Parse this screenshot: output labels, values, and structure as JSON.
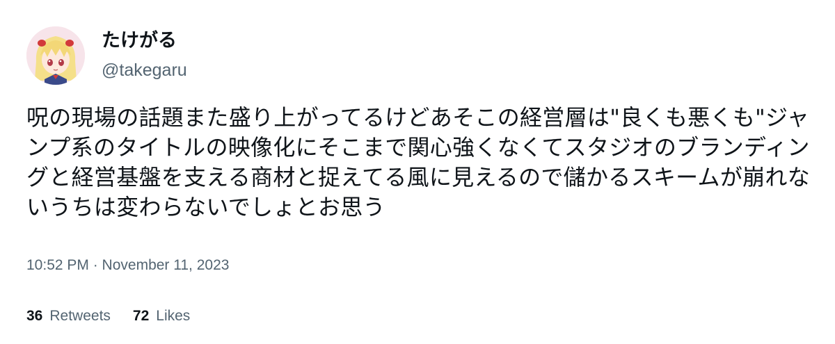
{
  "author": {
    "display_name": "たけがる",
    "handle": "@takegaru"
  },
  "tweet": {
    "text": "呪の現場の話題また盛り上がってるけどあそこの経営層は\"良くも悪くも\"ジャンプ系のタイトルの映像化にそこまで関心強くなくてスタジオのブランディングと経営基盤を支える商材と捉えてる風に見えるので儲かるスキームが崩れないうちは変わらないでしょとお思う",
    "timestamp": "10:52 PM · November 11, 2023"
  },
  "stats": {
    "retweets_count": "36",
    "retweets_label": "Retweets",
    "likes_count": "72",
    "likes_label": "Likes"
  },
  "colors": {
    "text_primary": "#0f1419",
    "text_secondary": "#536471",
    "background": "#ffffff"
  }
}
